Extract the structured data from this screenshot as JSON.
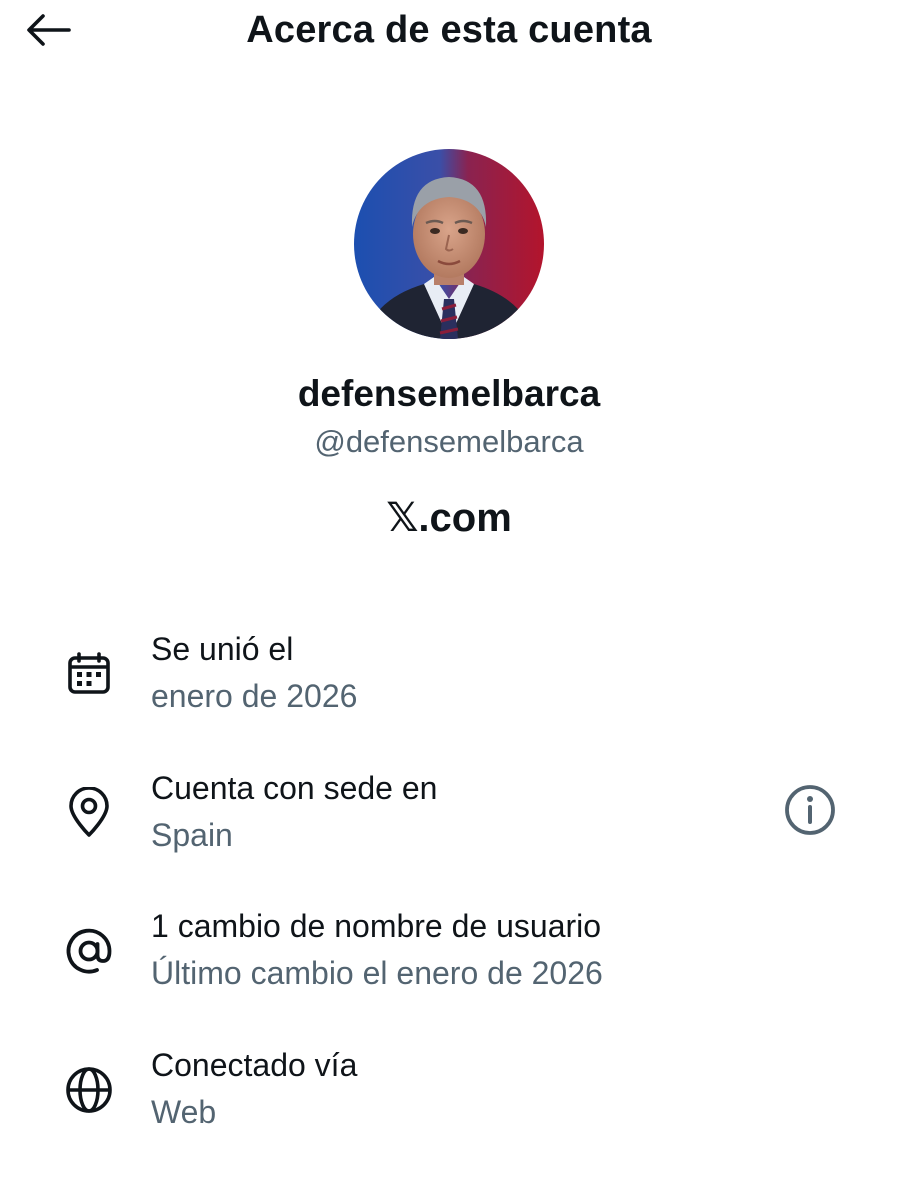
{
  "header": {
    "title": "Acerca de esta cuenta",
    "back_icon": "arrow-left-icon"
  },
  "profile": {
    "display_name": "defensemelbarca",
    "handle": "@defensemelbarca",
    "platform": "𝕏.com",
    "avatar_bg_colors": [
      "#1a5fb4",
      "#b8102e"
    ]
  },
  "details": [
    {
      "icon": "calendar-icon",
      "title": "Se unió el",
      "value": "enero de 2026"
    },
    {
      "icon": "location-pin-icon",
      "title": "Cuenta con sede en",
      "value": "Spain",
      "action_icon": "info-icon"
    },
    {
      "icon": "at-sign-icon",
      "title": "1 cambio de nombre de usuario",
      "value": "Último cambio el enero de 2026"
    },
    {
      "icon": "globe-icon",
      "title": "Conectado vía",
      "value": "Web"
    }
  ],
  "colors": {
    "primary_text": "#0f1419",
    "secondary_text": "#536471",
    "background": "#ffffff"
  }
}
